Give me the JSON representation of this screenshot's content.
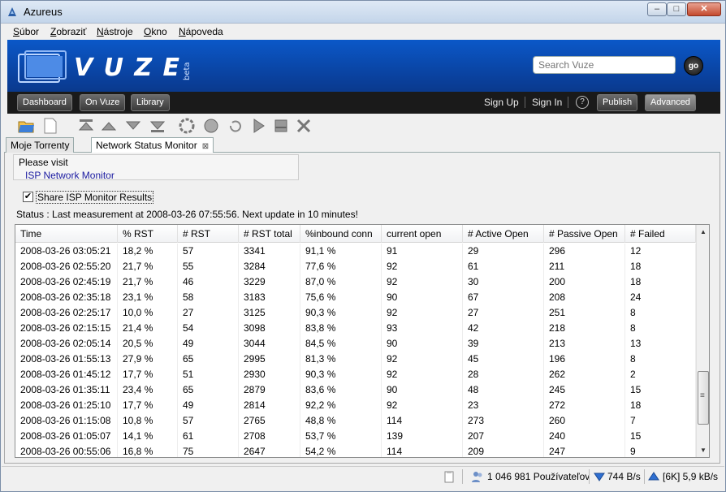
{
  "window": {
    "title": "Azureus",
    "min_glyph": "–",
    "max_glyph": "□",
    "close_glyph": "✕"
  },
  "menu": [
    {
      "underlined": "S",
      "rest": "úbor"
    },
    {
      "underlined": "Z",
      "rest": "obraziť"
    },
    {
      "underlined": "N",
      "rest": "ástroje"
    },
    {
      "underlined": "O",
      "rest": "kno"
    },
    {
      "underlined": "N",
      "rest": "ápoveda"
    }
  ],
  "header": {
    "logo_text": "VUZE",
    "logo_badge": "beta",
    "search_placeholder": "Search Vuze",
    "go_label": "go",
    "nav_buttons": [
      "Dashboard",
      "On Vuze",
      "Library"
    ],
    "sign_up": "Sign Up",
    "sign_in": "Sign In",
    "help_label": "?",
    "publish": "Publish",
    "advanced": "Advanced"
  },
  "tabs": {
    "first": "Moje Torrenty",
    "active": "Network Status Monitor",
    "close_glyph": "⊠"
  },
  "panel": {
    "visit_label": "Please visit",
    "visit_link": "ISP Network Monitor",
    "share_label": "Share ISP Monitor Results",
    "share_checked_glyph": "✔",
    "status": "Status :  Last measurement at 2008-03-26 07:55:56. Next update in 10 minutes!"
  },
  "table": {
    "columns": [
      "Time",
      "% RST",
      "# RST",
      "# RST total",
      "%inbound conn",
      "current open",
      "# Active Open",
      "# Passive Open",
      "# Failed"
    ],
    "rows": [
      [
        "2008-03-26 03:05:21",
        "18,2 %",
        "57",
        "3341",
        "91,1 %",
        "91",
        "29",
        "296",
        "12"
      ],
      [
        "2008-03-26 02:55:20",
        "21,7 %",
        "55",
        "3284",
        "77,6 %",
        "92",
        "61",
        "211",
        "18"
      ],
      [
        "2008-03-26 02:45:19",
        "21,7 %",
        "46",
        "3229",
        "87,0 %",
        "92",
        "30",
        "200",
        "18"
      ],
      [
        "2008-03-26 02:35:18",
        "23,1 %",
        "58",
        "3183",
        "75,6 %",
        "90",
        "67",
        "208",
        "24"
      ],
      [
        "2008-03-26 02:25:17",
        "10,0 %",
        "27",
        "3125",
        "90,3 %",
        "92",
        "27",
        "251",
        "8"
      ],
      [
        "2008-03-26 02:15:15",
        "21,4 %",
        "54",
        "3098",
        "83,8 %",
        "93",
        "42",
        "218",
        "8"
      ],
      [
        "2008-03-26 02:05:14",
        "20,5 %",
        "49",
        "3044",
        "84,5 %",
        "90",
        "39",
        "213",
        "13"
      ],
      [
        "2008-03-26 01:55:13",
        "27,9 %",
        "65",
        "2995",
        "81,3 %",
        "92",
        "45",
        "196",
        "8"
      ],
      [
        "2008-03-26 01:45:12",
        "17,7 %",
        "51",
        "2930",
        "90,3 %",
        "92",
        "28",
        "262",
        "2"
      ],
      [
        "2008-03-26 01:35:11",
        "23,4 %",
        "65",
        "2879",
        "83,6 %",
        "90",
        "48",
        "245",
        "15"
      ],
      [
        "2008-03-26 01:25:10",
        "17,7 %",
        "49",
        "2814",
        "92,2 %",
        "92",
        "23",
        "272",
        "18"
      ],
      [
        "2008-03-26 01:15:08",
        "10,8 %",
        "57",
        "2765",
        "48,8 %",
        "114",
        "273",
        "260",
        "7"
      ],
      [
        "2008-03-26 01:05:07",
        "14,1 %",
        "61",
        "2708",
        "53,7 %",
        "139",
        "207",
        "240",
        "15"
      ],
      [
        "2008-03-26 00:55:06",
        "16,8 %",
        "75",
        "2647",
        "54,2 %",
        "114",
        "209",
        "247",
        "9"
      ]
    ],
    "scroll_up_glyph": "▲",
    "scroll_down_glyph": "▼",
    "scroll_thumb_glyph": "≡"
  },
  "statusbar": {
    "users": "1 046 981 Používateľov",
    "download": "744 B/s",
    "upload": "[6K] 5,9 kB/s"
  },
  "colors": {
    "vuze_blue": "#0a4fb8",
    "navbar": "#1a1a1a",
    "link": "#1a1aa0"
  }
}
